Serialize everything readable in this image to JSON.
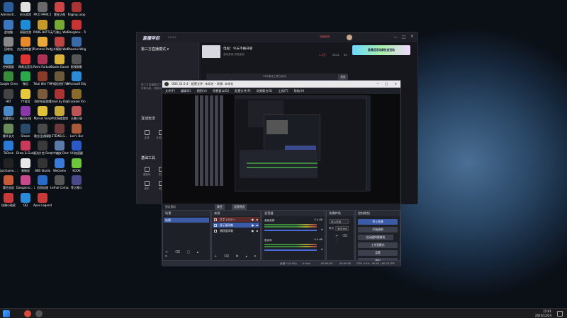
{
  "desktop_icons": [
    {
      "label": "Administr...",
      "color": "#2a5d9a"
    },
    {
      "label": "妙乐游戏",
      "color": "#e0e0e0"
    },
    {
      "label": "PICO PARK 2",
      "color": "#6a6a6a"
    },
    {
      "label": "堡垒之夜",
      "color": "#c44"
    },
    {
      "label": "Raging Loop",
      "color": "#a33"
    },
    {
      "label": "此电脑",
      "color": "#3b78c0"
    },
    {
      "label": "网易优游",
      "color": "#1e8dd8"
    },
    {
      "label": "PUBG BATTLEGR...",
      "color": "#c69a2a"
    },
    {
      "label": "元气骑士 WeGame版",
      "color": "#7a3"
    },
    {
      "label": "Dangano... Trigger H...",
      "color": "#c33"
    },
    {
      "label": "回收站",
      "color": "#888"
    },
    {
      "label": "点点游戏盒子",
      "color": "#e88a2a"
    },
    {
      "label": "Pummel Party",
      "color": "#e8a93a"
    },
    {
      "label": "山羊模拟 WeGame版",
      "color": "#b44"
    },
    {
      "label": "Phoenix Wright A...",
      "color": "#3a6aa8"
    },
    {
      "label": "控制面板",
      "color": "#3a8ac8"
    },
    {
      "label": "网易云音乐",
      "color": "#d33"
    },
    {
      "label": "Remi Fortune ...",
      "color": "#a35"
    },
    {
      "label": "Goose Goose Duck",
      "color": "#d9b23a"
    },
    {
      "label": "影视剧影",
      "color": "#555"
    },
    {
      "label": "Google Chrome",
      "color": "#3a8a3a"
    },
    {
      "label": "微信",
      "color": "#2aa84a"
    },
    {
      "label": "Total War THREE K...",
      "color": "#8a3a2a"
    },
    {
      "label": "不相信他们 Wolfgrom...",
      "color": "#6a5a3a"
    },
    {
      "label": "Microsoft Edge",
      "color": "#2a8ad8"
    },
    {
      "label": "HKT",
      "color": "#444"
    },
    {
      "label": "YY语音",
      "color": "#e8c83a"
    },
    {
      "label": "羽你充录游戏",
      "color": "#7a5a3a"
    },
    {
      "label": "Dead by Daylight",
      "color": "#a33"
    },
    {
      "label": "Crusader Kings III",
      "color": "#8a6a2a"
    },
    {
      "label": "白鹿空山",
      "color": "#4a8ac8"
    },
    {
      "label": "精灵幻境",
      "color": "#8a3aa8"
    },
    {
      "label": "Marvel Snap",
      "color": "#e0c03a"
    },
    {
      "label": "中文网络游戏",
      "color": "#c8a83a"
    },
    {
      "label": "天美小说",
      "color": "#b55"
    },
    {
      "label": "睡羊长大",
      "color": "#6a8a5a"
    },
    {
      "label": "Steam",
      "color": "#2a4a6a"
    },
    {
      "label": "歌谷注进精版",
      "color": "#4a4a4a"
    },
    {
      "label": "STEINS;G...",
      "color": "#6a3a3a"
    },
    {
      "label": "Lier's Bar",
      "color": "#a85a3a"
    },
    {
      "label": "ToDesk",
      "color": "#2a7ad8"
    },
    {
      "label": "Draw & Guess - ...",
      "color": "#c83a5a"
    },
    {
      "label": "混沌片定 Demo",
      "color": "#3a3a3a"
    },
    {
      "label": "水中幽安 Demo",
      "color": "#5a7aa8"
    },
    {
      "label": "UU加速器",
      "color": "#2a5ac8"
    },
    {
      "label": "EpicGame... 游戏什么",
      "color": "#222"
    },
    {
      "label": "青物说",
      "color": "#e8e8e8"
    },
    {
      "label": "OBS Studio",
      "color": "#333"
    },
    {
      "label": "WeGame",
      "color": "#3a7ad8"
    },
    {
      "label": "KOOK",
      "color": "#6ac83a"
    },
    {
      "label": "重生追追",
      "color": "#c85a3a"
    },
    {
      "label": "Danganro... 2 Goodb...",
      "color": "#c84a8a"
    },
    {
      "label": "迅游加速",
      "color": "#2a6ac8"
    },
    {
      "label": "Lethal Company",
      "color": "#555"
    },
    {
      "label": "等之睡小",
      "color": "#4a4a8a"
    },
    {
      "label": "炫骑小绘家",
      "color": "#c83a3a"
    },
    {
      "label": "QQ",
      "color": "#2a8ad8"
    },
    {
      "label": "Apex Legends",
      "color": "#c83a3a"
    }
  ],
  "live_app": {
    "logo": "直播伴侣",
    "version": "V3.4.4",
    "top_badge": "升级所有",
    "side_section_title": "第三方直播模式 ▾",
    "side_description": "第三方直播模式下，直播伴侣将不提供直播画面采集功能，请使用OBS等第三方软件进行推流",
    "interact_title": "互动玩法",
    "basic_title": "基础工具",
    "tools": [
      "连线",
      "互动玩法",
      "投票",
      "直播间",
      "红包",
      "福袋",
      "更多",
      "设置",
      "屏幕"
    ],
    "stream_title": "电视：今天不换开管",
    "stream_meta": "游戏其他  标签定制",
    "stats": [
      "1.4万",
      "5412",
      "64"
    ],
    "banner": "直播迎活动赛包进活动",
    "obs_notice": "OBS推流工具已启动",
    "notice_btn": "更新"
  },
  "obs": {
    "title": "OBS 32.0.4 - 配置文件: 未命名 - 场景: 未命名",
    "menu": [
      "文件(F)",
      "编辑(E)",
      "视图(V)",
      "停靠窗口(D)",
      "配置文件(P)",
      "场景集合(S)",
      "工具(T)",
      "帮助(H)"
    ],
    "source_bar": [
      "图层截取",
      "属性",
      "滤镜筛选"
    ],
    "scenes_title": "场景",
    "scene_item": "场景",
    "sources_title": "来源",
    "sources": [
      "文字 (GDI+)",
      "显示器采集",
      "捕获器采集"
    ],
    "mixer_title": "混音器",
    "mixer_tracks": [
      "桌面音频",
      "麦克风"
    ],
    "mixer_db": [
      "0.0 dB",
      "0.0 dB"
    ],
    "transition_title": "场景转场",
    "transition_value": "淡入淡出",
    "duration_label": "时长",
    "duration_value": "300 ms",
    "controls_title": "控制按钮",
    "controls": [
      "停止直播",
      "开始录制",
      "启动虚拟摄像机",
      "工作室模式",
      "设置",
      "退出"
    ],
    "status": [
      "丢帧 0 (0.0%)",
      "0 kb/s",
      "00:00:00",
      "00:00:00",
      "CPU: 0.4%",
      "60.00 / 60.00 FPS"
    ]
  },
  "taskbar": {
    "time": "15:01",
    "date": "2025/12/24"
  }
}
